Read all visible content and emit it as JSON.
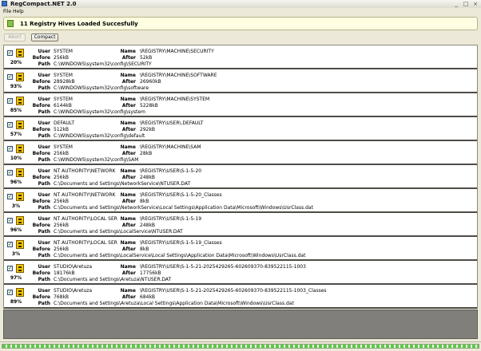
{
  "window": {
    "title": "RegCompact.NET 2.0",
    "controls": [
      "_",
      "□",
      "×"
    ]
  },
  "menu": {
    "file": "File",
    "help": "Help"
  },
  "banner": {
    "message": "11 Registry Hives Loaded Succesfully"
  },
  "toolbar": {
    "abort_label": "Abort",
    "compact_label": "Compact"
  },
  "labels": {
    "user": "User",
    "before": "Before",
    "path": "Path",
    "name": "Name",
    "after": "After"
  },
  "hives": [
    {
      "checked": true,
      "percent": "20%",
      "user": "SYSTEM",
      "before": "256kB",
      "path": "C:\\WINDOWS\\system32\\config\\SECURITY",
      "name": "\\REGISTRY\\MACHINE\\SECURITY",
      "after": "52kB"
    },
    {
      "checked": true,
      "percent": "93%",
      "user": "SYSTEM",
      "before": "28928kB",
      "path": "C:\\WINDOWS\\system32\\config\\software",
      "name": "\\REGISTRY\\MACHINE\\SOFTWARE",
      "after": "26960kB"
    },
    {
      "checked": true,
      "percent": "85%",
      "user": "SYSTEM",
      "before": "6144kB",
      "path": "C:\\WINDOWS\\system32\\config\\system",
      "name": "\\REGISTRY\\MACHINE\\SYSTEM",
      "after": "5228kB"
    },
    {
      "checked": true,
      "percent": "57%",
      "user": "DEFAULT",
      "before": "512kB",
      "path": "C:\\WINDOWS\\system32\\config\\default",
      "name": "\\REGISTRY\\USER\\.DEFAULT",
      "after": "292kB"
    },
    {
      "checked": true,
      "percent": "10%",
      "user": "SYSTEM",
      "before": "256kB",
      "path": "C:\\WINDOWS\\system32\\config\\SAM",
      "name": "\\REGISTRY\\MACHINE\\SAM",
      "after": "28kB"
    },
    {
      "checked": true,
      "percent": "96%",
      "user": "NT AUTHORITY\\NETWORK",
      "before": "256kB",
      "path": "C:\\Documents and Settings\\NetworkService\\NTUSER.DAT",
      "name": "\\REGISTRY\\USER\\S-1-5-20",
      "after": "248kB"
    },
    {
      "checked": true,
      "percent": "3%",
      "user": "NT AUTHORITY\\NETWORK",
      "before": "256kB",
      "path": "C:\\Documents and Settings\\NetworkService\\Local Settings\\Application Data\\Microsoft\\Windows\\UsrClass.dat",
      "name": "\\REGISTRY\\USER\\S-1-5-20_Classes",
      "after": "8kB"
    },
    {
      "checked": true,
      "percent": "96%",
      "user": "NT AUTHORITY\\LOCAL SER",
      "before": "256kB",
      "path": "C:\\Documents and Settings\\LocalService\\NTUSER.DAT",
      "name": "\\REGISTRY\\USER\\S-1-5-19",
      "after": "248kB"
    },
    {
      "checked": true,
      "percent": "3%",
      "user": "NT AUTHORITY\\LOCAL SER",
      "before": "256kB",
      "path": "C:\\Documents and Settings\\LocalService\\Local Settings\\Application Data\\Microsoft\\Windows\\UsrClass.dat",
      "name": "\\REGISTRY\\USER\\S-1-5-19_Classes",
      "after": "8kB"
    },
    {
      "checked": true,
      "percent": "97%",
      "user": "STUDIO\\Aretuza",
      "before": "18176kB",
      "path": "C:\\Documents and Settings\\Aretuza\\NTUSER.DAT",
      "name": "\\REGISTRY\\USER\\S-1-5-21-2025429265-602609370-839522115-1003",
      "after": "17756kB"
    },
    {
      "checked": true,
      "percent": "89%",
      "user": "STUDIO\\Aretuza",
      "before": "768kB",
      "path": "C:\\Documents and Settings\\Aretuza\\Local Settings\\Application Data\\Microsoft\\Windows\\UsrClass.dat",
      "name": "\\REGISTRY\\USER\\S-1-5-21-2025429265-602609370-839522115-1003_Classes",
      "after": "684kB"
    }
  ]
}
